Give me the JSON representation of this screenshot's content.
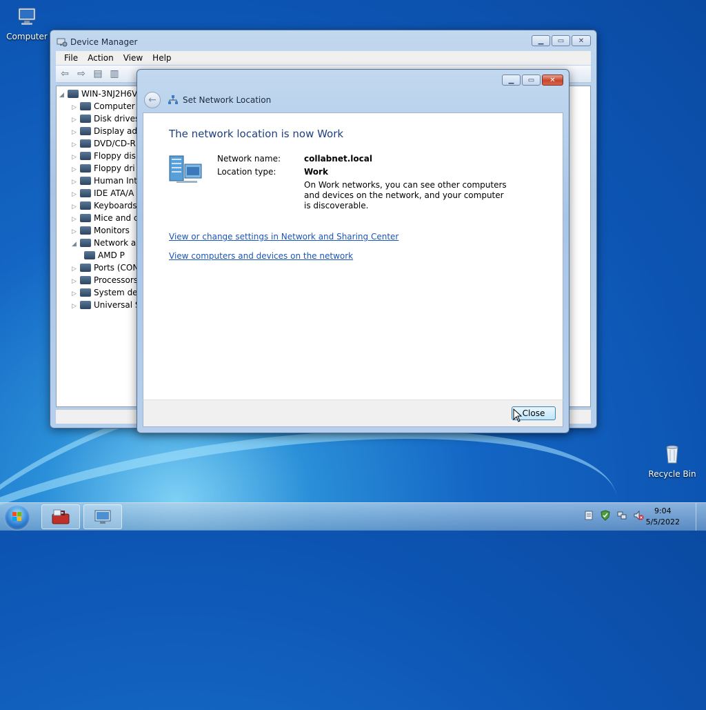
{
  "desktop": {
    "computer_label": "Computer",
    "recycle_label": "Recycle Bin"
  },
  "device_manager": {
    "title": "Device Manager",
    "menu": [
      "File",
      "Action",
      "View",
      "Help"
    ],
    "root": "WIN-3NJ2H6V",
    "items": [
      {
        "label": "Computer",
        "expanded": false
      },
      {
        "label": "Disk drives",
        "expanded": false
      },
      {
        "label": "Display ad",
        "expanded": false
      },
      {
        "label": "DVD/CD-R",
        "expanded": false
      },
      {
        "label": "Floppy dis",
        "expanded": false
      },
      {
        "label": "Floppy dri",
        "expanded": false
      },
      {
        "label": "Human Int",
        "expanded": false
      },
      {
        "label": "IDE ATA/A",
        "expanded": false
      },
      {
        "label": "Keyboards",
        "expanded": false
      },
      {
        "label": "Mice and c",
        "expanded": false
      },
      {
        "label": "Monitors",
        "expanded": false
      },
      {
        "label": "Network a",
        "expanded": true
      },
      {
        "label": "AMD P",
        "child": true
      },
      {
        "label": "Ports (CON",
        "expanded": false
      },
      {
        "label": "Processors",
        "expanded": false
      },
      {
        "label": "System de",
        "expanded": false
      },
      {
        "label": "Universal S",
        "expanded": false
      }
    ]
  },
  "dialog": {
    "title": "Set Network Location",
    "heading": "The network location is now Work",
    "network_name_label": "Network name:",
    "network_name_value": "collabnet.local",
    "location_type_label": "Location type:",
    "location_type_value": "Work",
    "description": "On Work networks, you can see other computers and devices on the network, and your computer is discoverable.",
    "link1": "View or change settings in Network and Sharing Center",
    "link2": "View computers and devices on the network",
    "close_button": "Close"
  },
  "taskbar": {
    "time": "9:04",
    "date": "5/5/2022"
  }
}
